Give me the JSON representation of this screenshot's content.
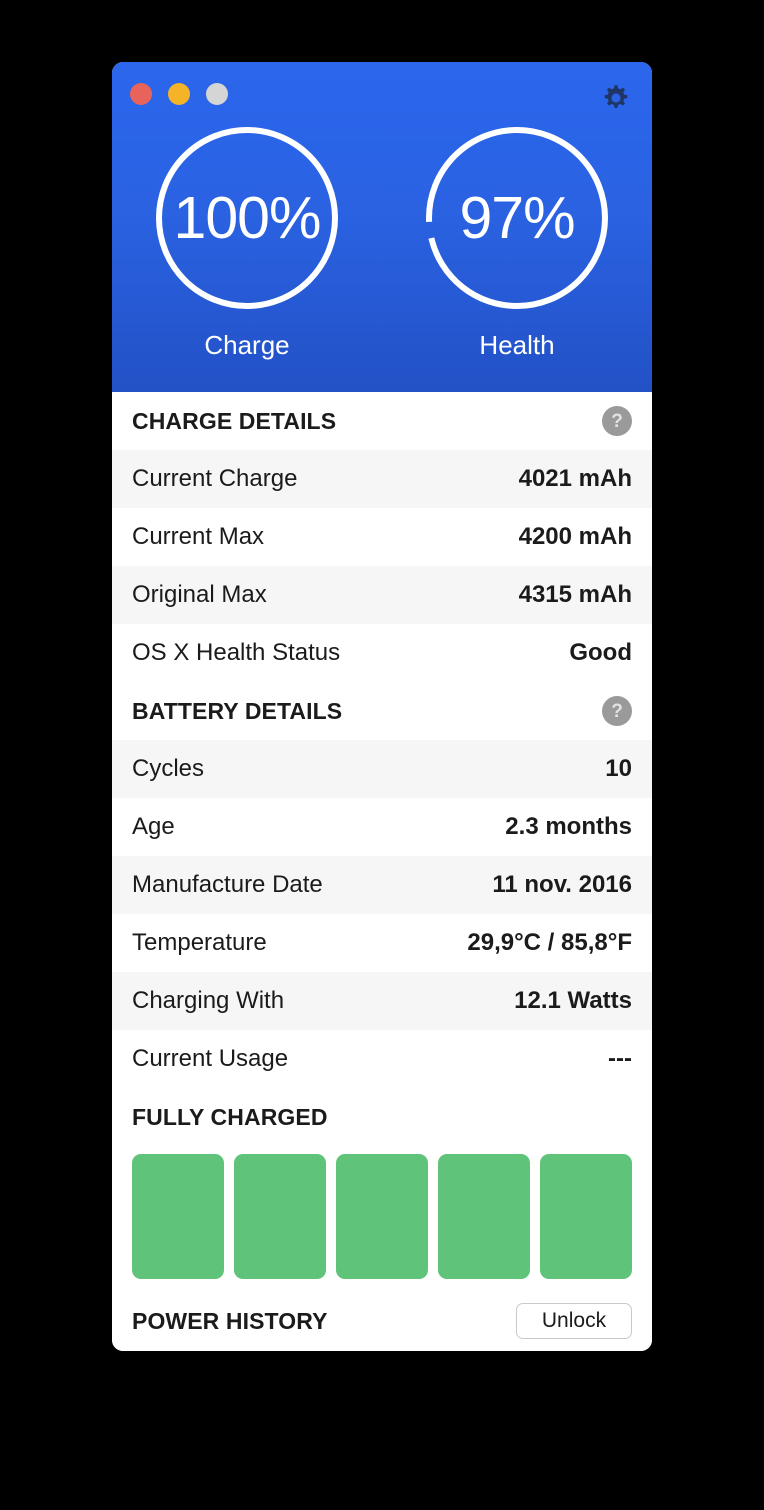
{
  "window": {
    "traffic_lights": [
      {
        "name": "close",
        "color": "#e8635a"
      },
      {
        "name": "minimize",
        "color": "#f5b327"
      },
      {
        "name": "zoom",
        "color": "#d5d5d5"
      }
    ],
    "settings_icon": "gear-icon",
    "accent_blue": "#2b66ec",
    "bar_green": "#5fc47a"
  },
  "gauges": [
    {
      "value": "100%",
      "label": "Charge",
      "percent": 100
    },
    {
      "value": "97%",
      "label": "Health",
      "percent": 97
    }
  ],
  "charge_details": {
    "title": "CHARGE DETAILS",
    "help": "?",
    "rows": [
      {
        "label": "Current Charge",
        "value": "4021 mAh"
      },
      {
        "label": "Current Max",
        "value": "4200 mAh"
      },
      {
        "label": "Original Max",
        "value": "4315 mAh"
      },
      {
        "label": "OS X Health Status",
        "value": "Good"
      }
    ]
  },
  "battery_details": {
    "title": "BATTERY DETAILS",
    "help": "?",
    "rows": [
      {
        "label": "Cycles",
        "value": "10"
      },
      {
        "label": "Age",
        "value": "2.3 months"
      },
      {
        "label": "Manufacture Date",
        "value": "11 nov. 2016"
      },
      {
        "label": "Temperature",
        "value": "29,9°C / 85,8°F"
      },
      {
        "label": "Charging With",
        "value": "12.1 Watts"
      },
      {
        "label": "Current Usage",
        "value": "---"
      }
    ]
  },
  "fully_charged": {
    "title": "FULLY CHARGED",
    "bar_count": 5
  },
  "power_history": {
    "title": "POWER HISTORY",
    "unlock_label": "Unlock"
  }
}
